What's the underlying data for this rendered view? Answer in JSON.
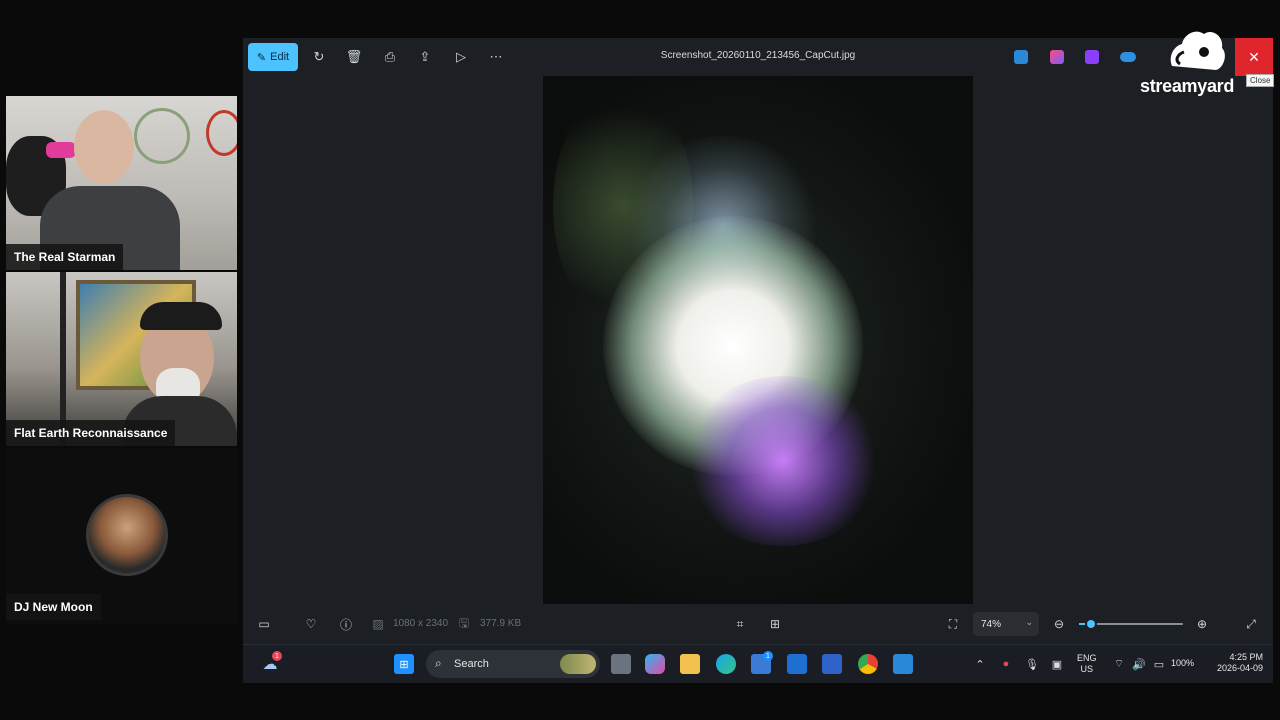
{
  "participants": [
    {
      "name": "The Real Starman"
    },
    {
      "name": "Flat Earth Reconnaissance"
    },
    {
      "name": "DJ New Moon"
    }
  ],
  "photos_app": {
    "edit_label": "Edit",
    "file_name": "Screenshot_20260110_213456_CapCut.jpg",
    "close_tooltip": "Close",
    "toolbar_icons": [
      "rotate-icon",
      "delete-icon",
      "print-icon",
      "share-icon",
      "slideshow-icon",
      "more-icon"
    ],
    "status": {
      "dimensions": "1080 x 2340",
      "file_size": "377.9 KB",
      "zoom_label": "74%",
      "zoom_level": 0.12
    }
  },
  "taskbar": {
    "search_placeholder": "Search",
    "weather_badge": "1",
    "store_badge": "1",
    "language": "ENG",
    "region": "US",
    "battery": "100%",
    "time": "4:25 PM",
    "date": "2026-04-09"
  },
  "branding": {
    "logo_text": "streamyard",
    "accent": "#4cc2ff",
    "close_color": "#e0262c"
  }
}
